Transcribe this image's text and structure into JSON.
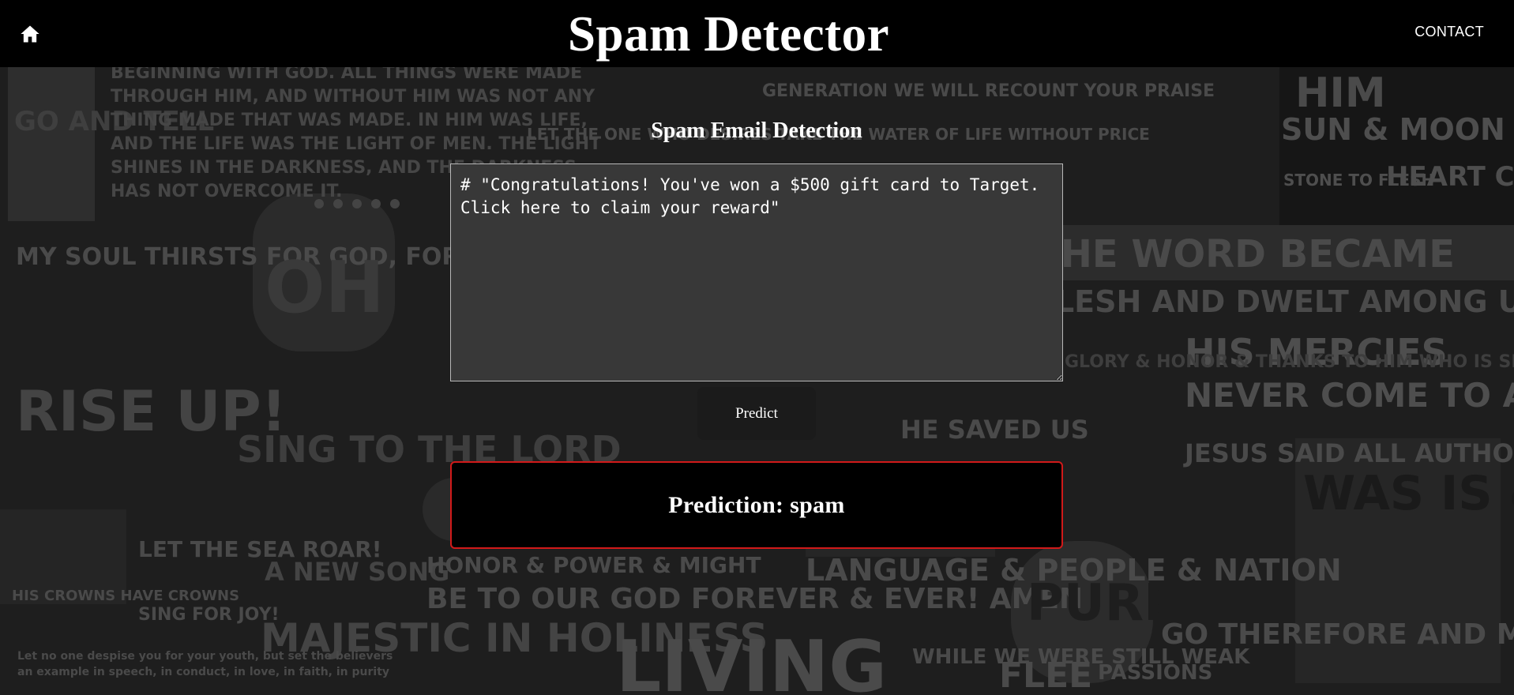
{
  "header": {
    "title": "Spam Detector",
    "contact_label": "CONTACT",
    "home_icon": "home-icon"
  },
  "form": {
    "heading": "Spam Email Detection",
    "email_text": "# \"Congratulations! You've won a $500 gift card to Target. Click here to claim your reward\"",
    "predict_label": "Predict"
  },
  "result": {
    "text": "Prediction: spam",
    "border_color": "#d11a1a"
  },
  "background": {
    "description_type": "decorative typographic collage",
    "phrases": [
      "GO AND TELL",
      "BEGINNING WITH GOD. ALL THINGS WERE MADE",
      "THROUGH HIM, AND WITHOUT HIM WAS NOT ANY",
      "THING MADE THAT WAS MADE. IN HIM WAS LIFE,",
      "AND THE LIFE WAS THE LIGHT OF MEN. THE LIGHT",
      "SHINES IN THE DARKNESS, AND THE DARKNESS",
      "HAS NOT OVERCOME IT.",
      "GENERATION WE WILL RECOUNT YOUR PRAISE",
      "LET THE ONE WHO DESIRES TAKE THE WATER OF LIFE WITHOUT PRICE",
      "HIM",
      "SUN & MOON",
      "STONE TO FLESH",
      "HEART CHANGE",
      "MY SOUL THIRSTS FOR GOD, FOR THE LIVING GOD",
      "OH",
      "THE WORD BECAME",
      "FLESH AND DWELT AMONG US",
      "HIS MERCIES",
      "NEVER COME TO AN END",
      "RISE UP!",
      "SING TO THE LORD",
      "A NEW SONG",
      "GLORY & HONOR & THANKS TO HIM WHO IS SEATED ON THE THRONE",
      "HE SAVED US",
      "JESUS SAID ALL AUTHORITY HAS BEEN GIVEN TO ME",
      "WAS IS & IS TO COME",
      "HONOR & POWER & MIGHT",
      "BE TO OUR GOD FOREVER & EVER! AMEN",
      "LANGUAGE & PEOPLE & NATION",
      "PURE",
      "GO THEREFORE AND MAKE DISCIPLES",
      "LET THE SEA ROAR!",
      "SING FOR JOY!",
      "HIS CROWNS HAVE CROWNS",
      "MAJESTIC IN HOLINESS",
      "LIVING",
      "WHILE WE WERE STILL WEAK",
      "FLEE",
      "PASSIONS",
      "Let no one despise you for your youth, but set the believers",
      "an example in speech, in conduct, in love, in faith, in purity"
    ]
  }
}
